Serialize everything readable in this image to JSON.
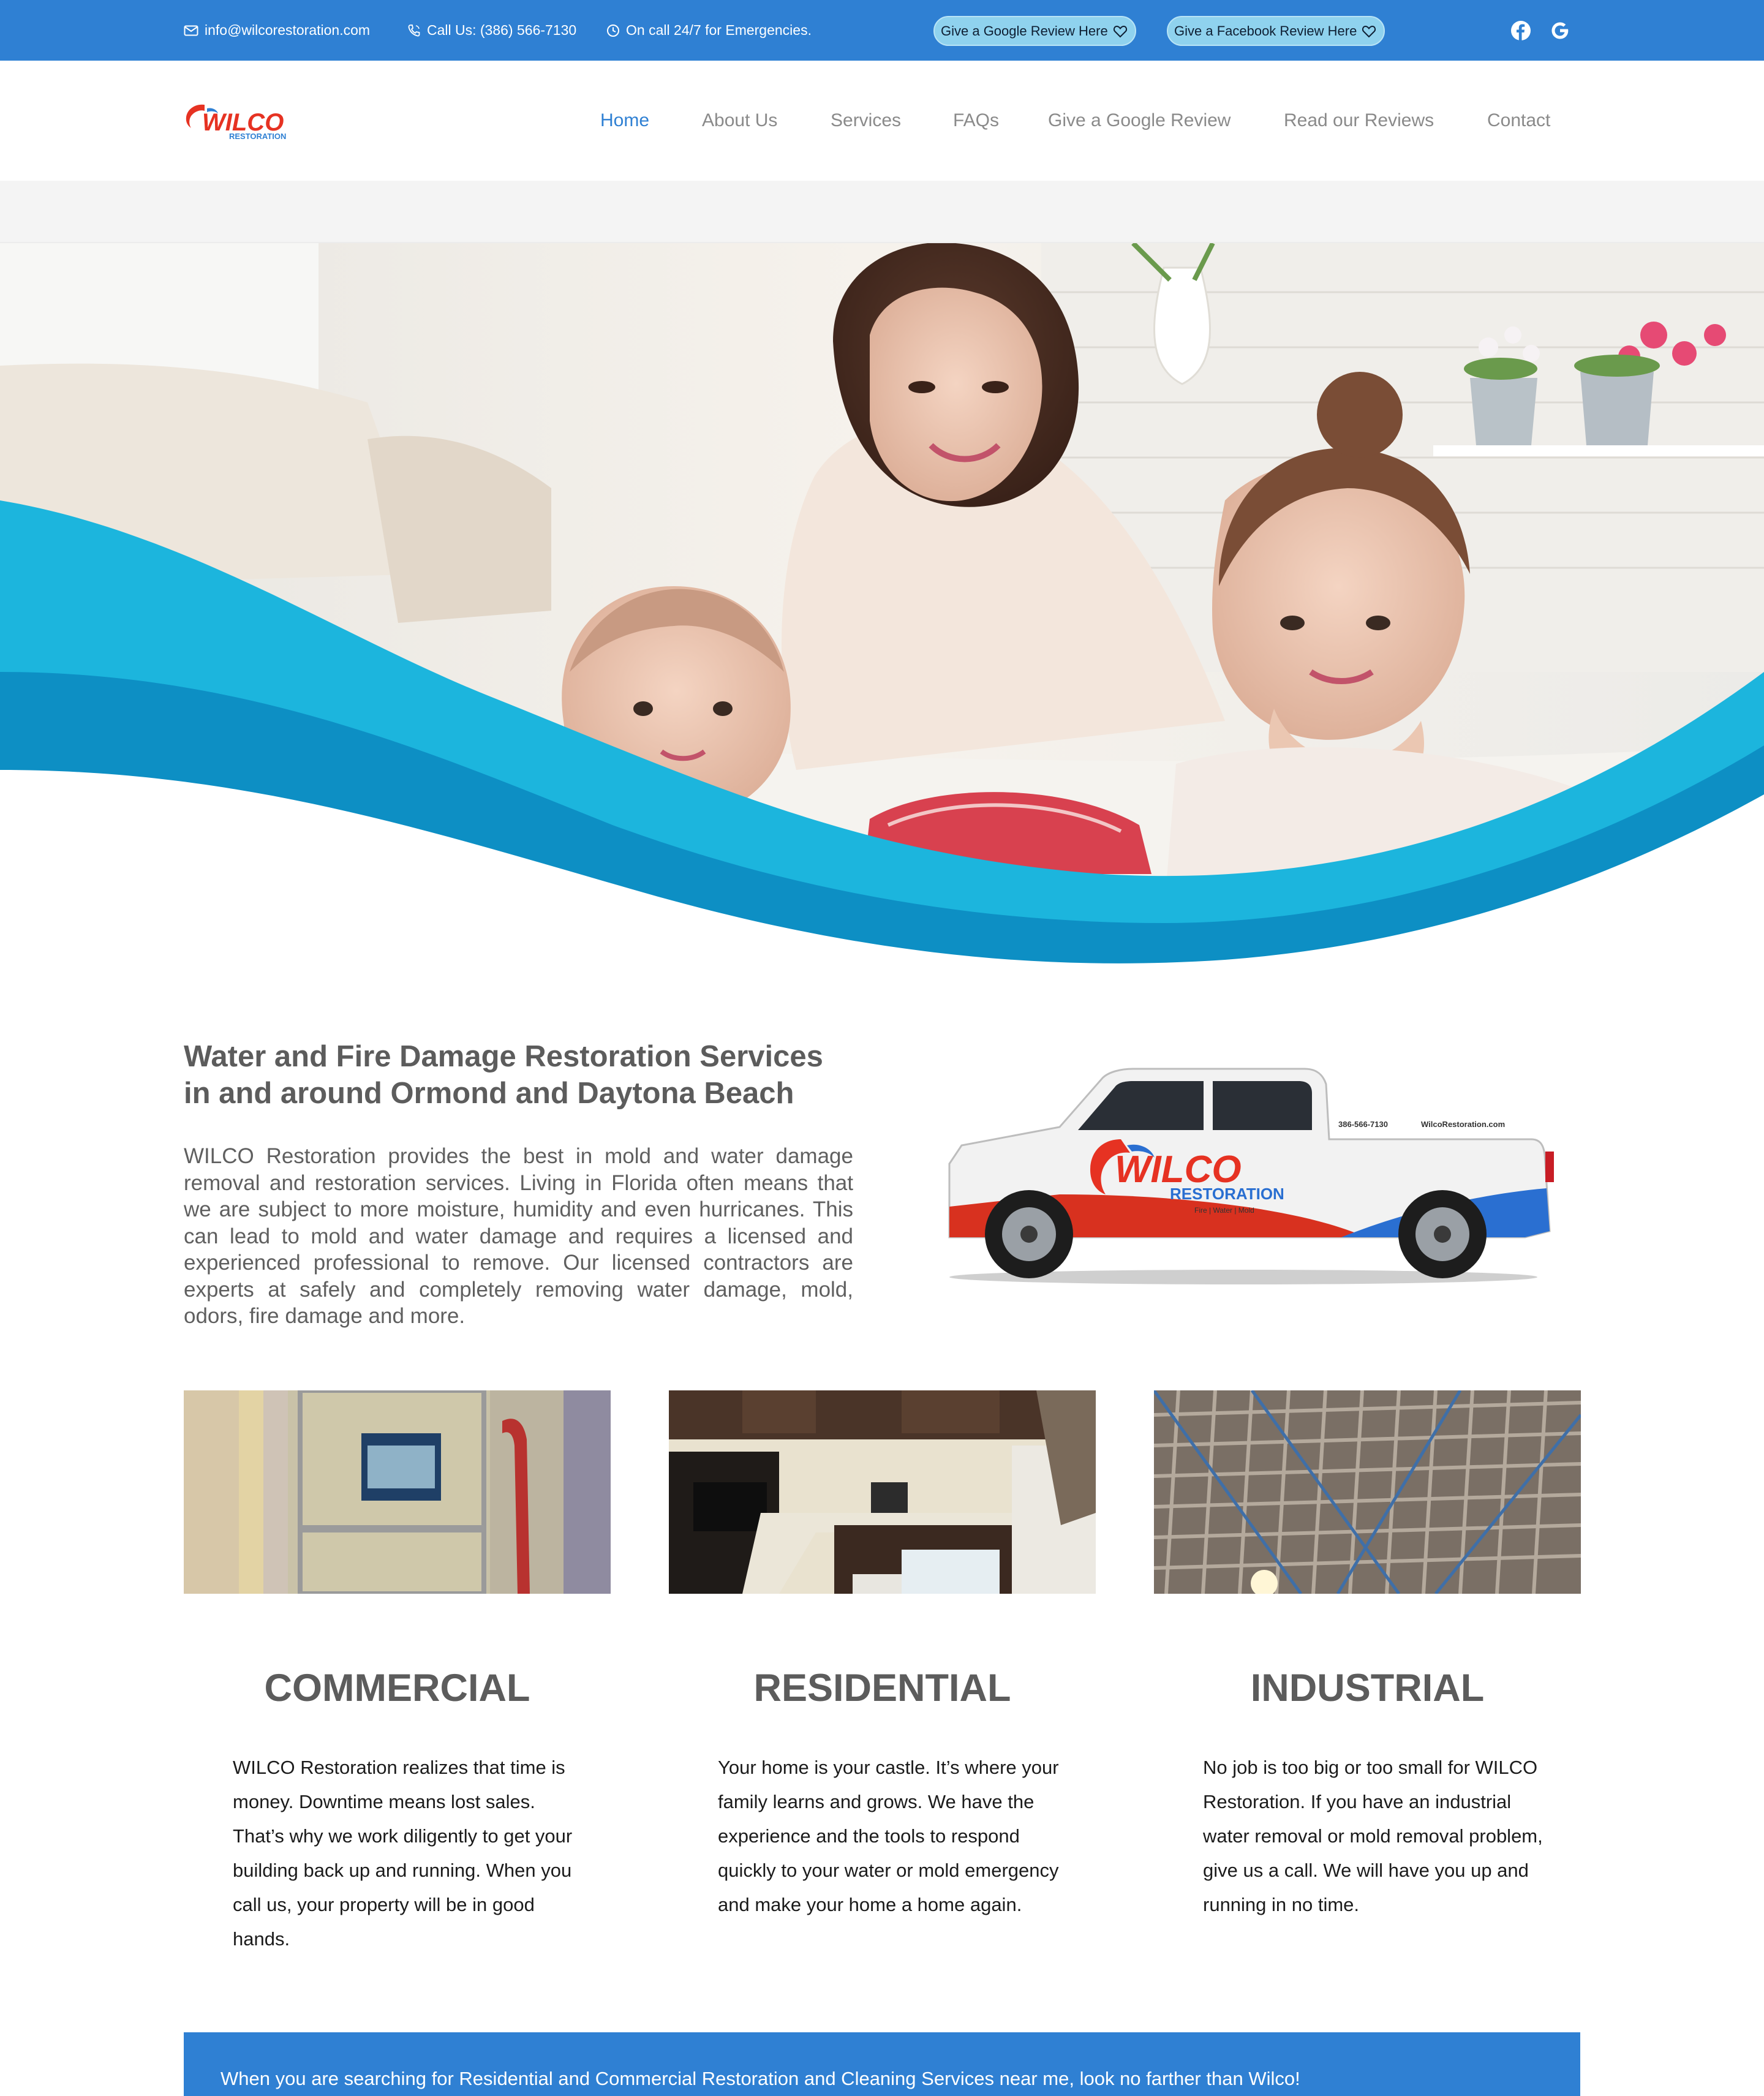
{
  "topbar": {
    "email": "info@wilcorestoration.com",
    "phone": "Call Us: (386) 566-7130",
    "oncall": "On call 24/7 for Emergencies.",
    "google_review_button": "Give a Google Review Here",
    "facebook_review_button": "Give a Facebook Review Here",
    "social_icons": [
      "facebook-icon",
      "google-icon"
    ]
  },
  "logo": {
    "name": "WILCO",
    "sub": "RESTORATION"
  },
  "nav": {
    "items": [
      "Home",
      "About Us",
      "Services",
      "FAQs",
      "Give a Google Review",
      "Read our Reviews",
      "Contact"
    ],
    "active": "Home"
  },
  "intro": {
    "title": "Water and Fire Damage Restoration Services in and around Ormond and Daytona Beach",
    "body": "WILCO Restoration provides the best in mold and water damage removal and restoration services. Living in Florida often means that we are subject to more moisture, humidity and even hurricanes. This can lead to mold and water damage and requires a licensed and experienced professional to remove. Our licensed contractors are experts at safely and completely removing water damage, mold, odors, fire damage and more."
  },
  "truck": {
    "brand": "WILCO",
    "sub": "RESTORATION",
    "tagline": "Fire | Water | Mold",
    "phone": "386-566-7130",
    "site": "WilcoRestoration.com"
  },
  "cards": [
    {
      "title": "COMMERCIAL",
      "text": "WILCO Restoration realizes that time is money. Downtime means lost sales. That’s why we work diligently to get your building back up and running. When you call us, your property will be in good hands."
    },
    {
      "title": "RESIDENTIAL",
      "text": "Your home is your castle. It’s where your family learns and grows. We have the experience and the tools to respond quickly to your water or mold emergency and make your home a home again."
    },
    {
      "title": "INDUSTRIAL",
      "text": "No job is too big or too small for WILCO Restoration. If you have an industrial water removal or mold removal problem, give us a call. We will have you up and running in no time."
    }
  ],
  "band": {
    "text": "When you are searching for Residential and Commercial Restoration and Cleaning Services near me, look no farther than Wilco!"
  },
  "colors": {
    "primary": "#2f80d3",
    "wave_light": "#1cb5dd",
    "wave_dark": "#0d8fc4",
    "logo_red": "#e63222"
  }
}
